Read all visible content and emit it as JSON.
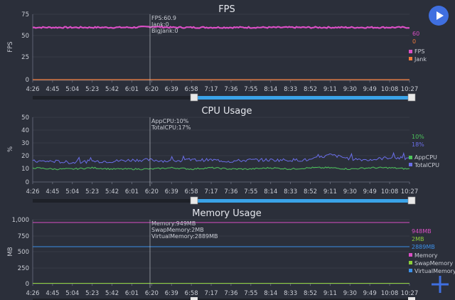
{
  "colors": {
    "background": "#2b2f3a",
    "fps": "#d94fc4",
    "jank": "#f07a3a",
    "app_cpu": "#4cc45a",
    "total_cpu": "#6a6ee8",
    "memory": "#d94fc4",
    "swap_memory": "#8ccf3a",
    "virtual_memory": "#3b8fe8",
    "accent": "#3f6fe0"
  },
  "controls": {
    "play_icon": "play-icon",
    "add_icon": "plus-icon"
  },
  "time_axis": [
    "4:26",
    "4:45",
    "5:04",
    "5:23",
    "5:42",
    "6:01",
    "6:20",
    "6:39",
    "6:58",
    "7:17",
    "7:36",
    "7:55",
    "8:14",
    "8:33",
    "8:52",
    "9:11",
    "9:30",
    "9:49",
    "10:08",
    "10:27"
  ],
  "charts": {
    "fps": {
      "title": "FPS",
      "ylabel": "FPS",
      "yticks": [
        "75",
        "50",
        "25",
        "0"
      ],
      "tooltip": [
        "FPS:60.9",
        "Jank:0",
        "BigJank:0"
      ],
      "values": [
        "60",
        "0"
      ],
      "legend": [
        "FPS",
        "Jank"
      ]
    },
    "cpu": {
      "title": "CPU Usage",
      "ylabel": "%",
      "yticks": [
        "50",
        "40",
        "30",
        "20",
        "10",
        "0"
      ],
      "tooltip": [
        "AppCPU:10%",
        "TotalCPU:17%"
      ],
      "values": [
        "10%",
        "18%"
      ],
      "legend": [
        "AppCPU",
        "TotalCPU"
      ]
    },
    "memory": {
      "title": "Memory Usage",
      "ylabel": "MB",
      "yticks": [
        "1,000",
        "750",
        "500",
        "250",
        "0"
      ],
      "tooltip": [
        "Memory:949MB",
        "SwapMemory:2MB",
        "VirtualMemory:2889MB"
      ],
      "values": [
        "948MB",
        "2MB",
        "2889MB"
      ],
      "legend": [
        "Memory",
        "SwapMemory",
        "VirtualMemory"
      ]
    }
  },
  "chart_data": [
    {
      "type": "line",
      "title": "FPS",
      "ylabel": "FPS",
      "x": [
        "4:26",
        "4:45",
        "5:04",
        "5:23",
        "5:42",
        "6:01",
        "6:20",
        "6:39",
        "6:58",
        "7:17",
        "7:36",
        "7:55",
        "8:14",
        "8:33",
        "8:52",
        "9:11",
        "9:30",
        "9:49",
        "10:08",
        "10:27"
      ],
      "ylim": [
        0,
        75
      ],
      "series": [
        {
          "name": "FPS",
          "values": [
            60,
            60,
            60,
            60,
            60,
            60,
            60.9,
            60,
            60,
            60,
            60,
            60,
            60,
            60,
            60,
            60,
            60,
            60,
            60,
            60
          ]
        },
        {
          "name": "Jank",
          "values": [
            0,
            0,
            0,
            0,
            0,
            0,
            0,
            0,
            0,
            0,
            0,
            0,
            0,
            0,
            0,
            0,
            0,
            0,
            0,
            0
          ]
        }
      ],
      "legend": "right"
    },
    {
      "type": "line",
      "title": "CPU Usage",
      "ylabel": "%",
      "x": [
        "4:26",
        "4:45",
        "5:04",
        "5:23",
        "5:42",
        "6:01",
        "6:20",
        "6:39",
        "6:58",
        "7:17",
        "7:36",
        "7:55",
        "8:14",
        "8:33",
        "8:52",
        "9:11",
        "9:30",
        "9:49",
        "10:08",
        "10:27"
      ],
      "ylim": [
        0,
        50
      ],
      "series": [
        {
          "name": "AppCPU",
          "values": [
            11,
            10,
            10,
            11,
            10,
            10,
            10,
            11,
            10,
            11,
            10,
            10,
            11,
            10,
            11,
            11,
            10,
            11,
            11,
            10
          ]
        },
        {
          "name": "TotalCPU",
          "values": [
            16,
            16,
            15,
            16,
            16,
            17,
            17,
            16,
            17,
            17,
            16,
            17,
            17,
            17,
            17,
            21,
            18,
            17,
            19,
            18
          ]
        }
      ],
      "legend": "right"
    },
    {
      "type": "line",
      "title": "Memory Usage",
      "ylabel": "MB",
      "x": [
        "4:26",
        "4:45",
        "5:04",
        "5:23",
        "5:42",
        "6:01",
        "6:20",
        "6:39",
        "6:58",
        "7:17",
        "7:36",
        "7:55",
        "8:14",
        "8:33",
        "8:52",
        "9:11",
        "9:30",
        "9:49",
        "10:08",
        "10:27"
      ],
      "ylim": [
        0,
        1000
      ],
      "series": [
        {
          "name": "Memory",
          "values": [
            948,
            948,
            948,
            948,
            948,
            948,
            949,
            948,
            948,
            948,
            948,
            948,
            948,
            948,
            948,
            948,
            948,
            948,
            948,
            948
          ]
        },
        {
          "name": "SwapMemory",
          "values": [
            2,
            2,
            2,
            2,
            2,
            2,
            2,
            2,
            2,
            2,
            2,
            2,
            2,
            2,
            2,
            2,
            2,
            2,
            2,
            2
          ]
        },
        {
          "name": "VirtualMemory",
          "values": [
            2889,
            2889,
            2889,
            2889,
            2889,
            2889,
            2889,
            2889,
            2889,
            2889,
            2889,
            2889,
            2889,
            2889,
            2889,
            2889,
            2889,
            2889,
            2889,
            2889
          ]
        }
      ],
      "legend": "right"
    }
  ]
}
